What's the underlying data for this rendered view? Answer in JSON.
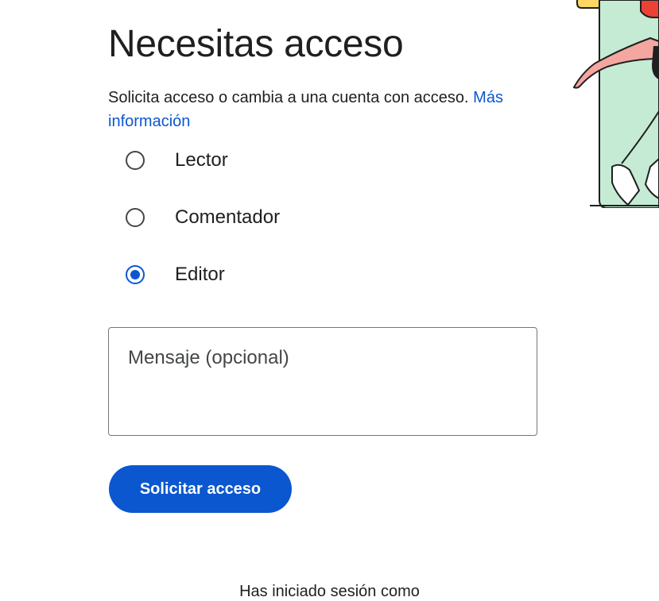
{
  "page": {
    "title": "Necesitas acceso",
    "description": "Solicita acceso o cambia a una cuenta con acceso.",
    "learn_more_link": "Más información"
  },
  "roles": {
    "selected": "Editor",
    "options": [
      {
        "label": "Lector",
        "checked": false
      },
      {
        "label": "Comentador",
        "checked": false
      },
      {
        "label": "Editor",
        "checked": true
      }
    ]
  },
  "message": {
    "placeholder": "Mensaje (opcional)",
    "value": ""
  },
  "actions": {
    "request_access_label": "Solicitar acceso"
  },
  "footer": {
    "signed_in_text": "Has iniciado sesión como"
  },
  "colors": {
    "accent": "#0b57d0",
    "text": "#1f1f1f",
    "illustration_green": "#c5ebd4",
    "illustration_pink": "#f4a6a0",
    "illustration_yellow": "#fdd663",
    "illustration_red": "#ea4335"
  }
}
